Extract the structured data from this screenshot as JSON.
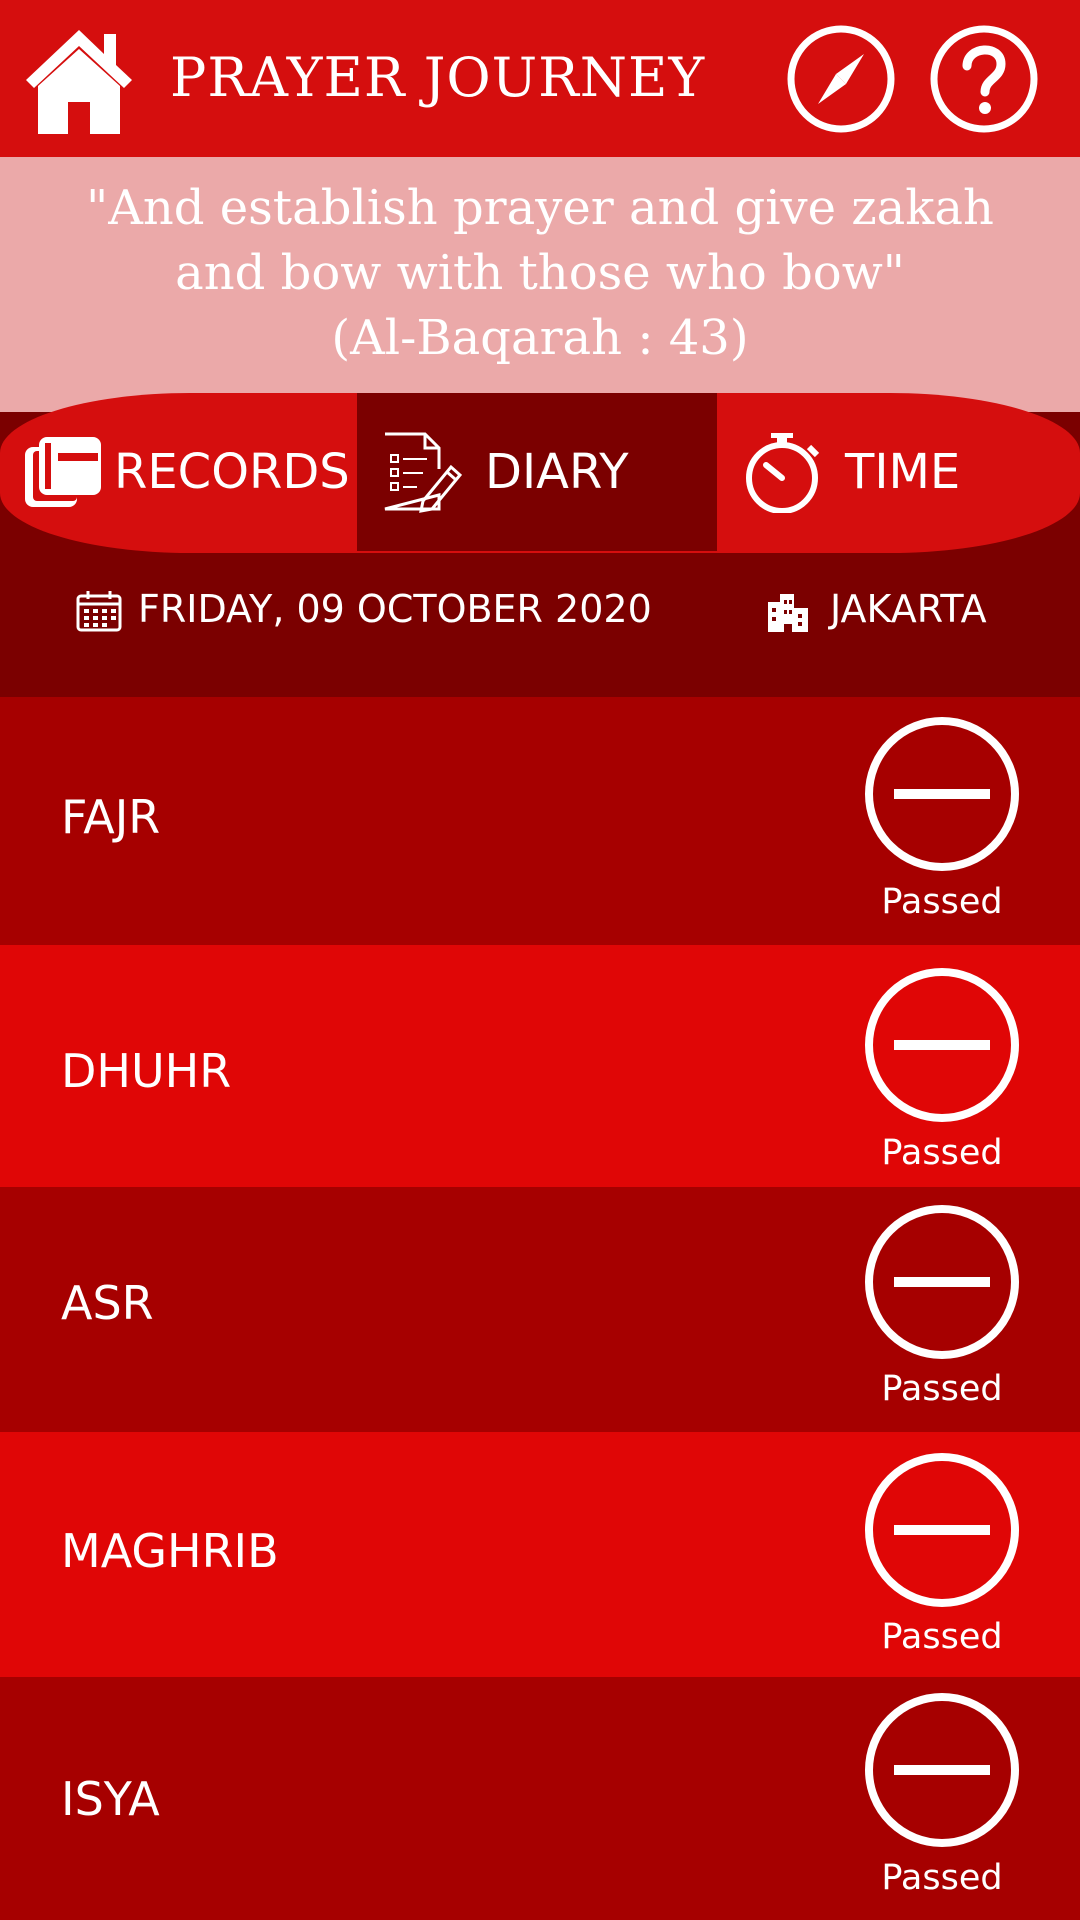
{
  "header": {
    "title": "PRAYER JOURNEY",
    "icons": [
      "home-icon",
      "compass-icon",
      "help-icon"
    ]
  },
  "verse": {
    "line1": "\"And establish prayer and give zakah",
    "line2": "and bow with those who bow\"",
    "reference": "(Al-Baqarah : 43)"
  },
  "tabs": [
    {
      "label": "RECORDS",
      "icon": "book-stack-icon",
      "active": false
    },
    {
      "label": "DIARY",
      "icon": "checklist-pencil-icon",
      "active": true
    },
    {
      "label": "TIME",
      "icon": "stopwatch-icon",
      "active": false
    }
  ],
  "info": {
    "date": "FRIDAY, 09 OCTOBER 2020",
    "city": "JAKARTA"
  },
  "prayers": [
    {
      "name": "FAJR",
      "status": "Passed"
    },
    {
      "name": "DHUHR",
      "status": "Passed"
    },
    {
      "name": "ASR",
      "status": "Passed"
    },
    {
      "name": "MAGHRIB",
      "status": "Passed"
    },
    {
      "name": "ISYA",
      "status": "Passed"
    }
  ],
  "colors": {
    "header_red": "#d50e0e",
    "verse_pink": "#eba9a9",
    "dark_maroon": "#7b0000",
    "row_dark": "#a60000",
    "row_bright": "#e00606"
  }
}
